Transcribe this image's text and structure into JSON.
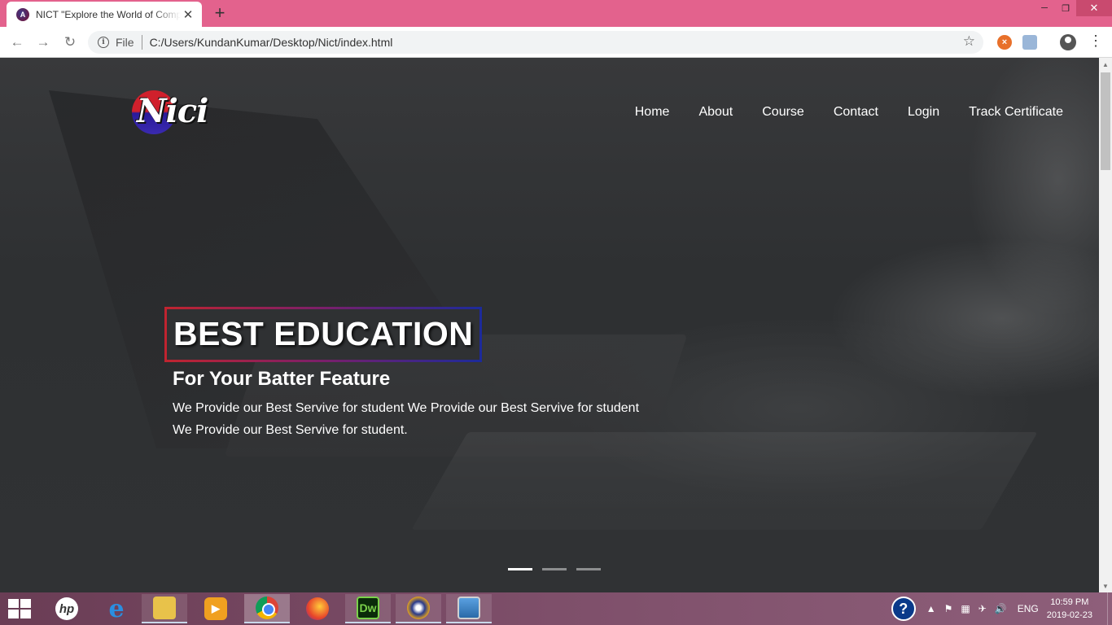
{
  "browser": {
    "tab_title": "NICT \"Explore the World of Comp",
    "tab_close": "✕",
    "new_tab": "+",
    "window_controls": {
      "minimize": "─",
      "maximize": "❐",
      "close": "✕"
    },
    "url_scheme": "File",
    "url": "C:/Users/KundanKumar/Desktop/Nict/index.html"
  },
  "site": {
    "logo_text": "Nici",
    "nav": [
      "Home",
      "About",
      "Course",
      "Contact",
      "Login",
      "Track Certificate"
    ],
    "hero": {
      "heading": "BEST EDUCATION",
      "subheading": "For Your Batter Feature",
      "text": "We Provide our Best Servive for student We Provide our Best Servive for student We Provide our Best Servive for student."
    },
    "carousel": {
      "slides": 3,
      "active_index": 0
    }
  },
  "taskbar": {
    "apps": [
      "hp",
      "Internet Explorer",
      "File Explorer",
      "Media Player",
      "Chrome",
      "Firefox",
      "Dw",
      "Burner",
      "Photos"
    ],
    "dw_label": "Dw",
    "language": "ENG",
    "time": "10:59 PM",
    "date": "2019-02-23"
  },
  "colors": {
    "titlebar": "#e3628d",
    "heading_border_start": "#c0242f",
    "heading_border_end": "#1c2a9a",
    "taskbar": "#7e4f6a"
  }
}
